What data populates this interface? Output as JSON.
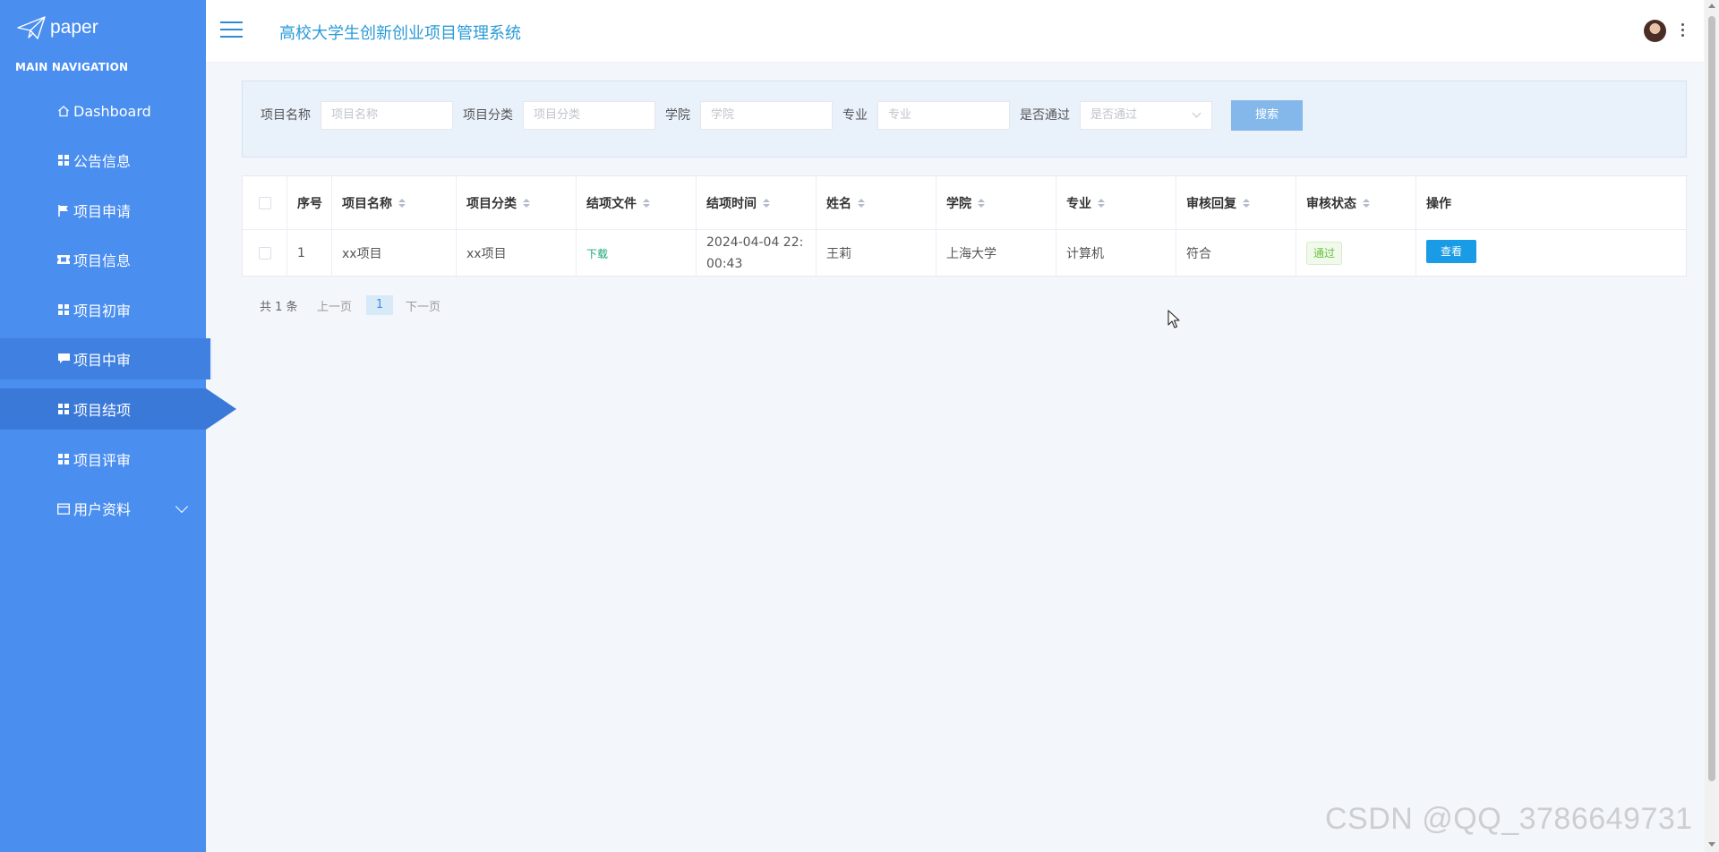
{
  "brand": {
    "name": "paper"
  },
  "sidebar": {
    "header": "MAIN NAVIGATION",
    "items": [
      {
        "label": "Dashboard",
        "icon": "home-icon"
      },
      {
        "label": "公告信息",
        "icon": "grid-icon"
      },
      {
        "label": "项目申请",
        "icon": "flag-icon"
      },
      {
        "label": "项目信息",
        "icon": "ticket-icon"
      },
      {
        "label": "项目初审",
        "icon": "grid-icon"
      },
      {
        "label": "项目中审",
        "icon": "comment-icon"
      },
      {
        "label": "项目结项",
        "icon": "grid-icon"
      },
      {
        "label": "项目评审",
        "icon": "grid-icon"
      },
      {
        "label": "用户资料",
        "icon": "calendar-icon"
      }
    ],
    "active_item": "项目结项",
    "hovered_item": "项目中审"
  },
  "header": {
    "title": "高校大学生创新创业项目管理系统"
  },
  "search": {
    "fields": [
      {
        "label": "项目名称",
        "placeholder": "项目名称"
      },
      {
        "label": "项目分类",
        "placeholder": "项目分类"
      },
      {
        "label": "学院",
        "placeholder": "学院"
      },
      {
        "label": "专业",
        "placeholder": "专业"
      },
      {
        "label": "是否通过",
        "placeholder": "是否通过"
      }
    ],
    "button": "搜索"
  },
  "table": {
    "columns": [
      "序号",
      "项目名称",
      "项目分类",
      "结项文件",
      "结项时间",
      "姓名",
      "学院",
      "专业",
      "审核回复",
      "审核状态",
      "操作"
    ],
    "rows": [
      {
        "index": "1",
        "name": "xx项目",
        "category": "xx项目",
        "file": "下载",
        "time": "2024-04-04 22:00:43",
        "person": "王莉",
        "college": "上海大学",
        "major": "计算机",
        "reply": "符合",
        "status": "通过",
        "action": "查看"
      }
    ]
  },
  "pagination": {
    "total": "共 1 条",
    "prev": "上一页",
    "current": "1",
    "next": "下一页"
  },
  "watermark": "CSDN @QQ_3786649731",
  "colors": {
    "sidebar": "#4a8ef0",
    "accent": "#2a9bd8",
    "primary_button": "#1a9be6",
    "search_button": "#84b8ea",
    "success": "#67c23a"
  }
}
